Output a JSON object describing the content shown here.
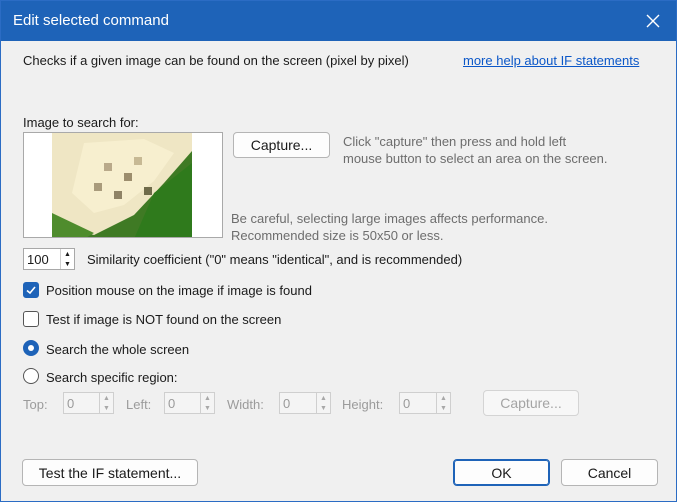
{
  "window": {
    "title": "Edit selected command"
  },
  "header": {
    "description": "Checks if a given image can be found on the screen (pixel by pixel)",
    "help_link": "more help about IF statements"
  },
  "image_section": {
    "label": "Image to search for:",
    "capture_button": "Capture...",
    "capture_hint_line1": "Click \"capture\" then press and hold left",
    "capture_hint_line2": "mouse button to select an area on the screen.",
    "warning_line1": "Be careful, selecting large images affects performance.",
    "warning_line2": "Recommended size is 50x50 or less."
  },
  "similarity": {
    "value": "100",
    "label": "Similarity coefficient (\"0\" means \"identical\", and is recommended)"
  },
  "options": {
    "position_mouse": {
      "label": "Position mouse on the image if image is found",
      "checked": true
    },
    "test_not_found": {
      "label": "Test if image is NOT found on the screen",
      "checked": false
    }
  },
  "search_mode": {
    "whole_screen": {
      "label": "Search the whole screen",
      "selected": true
    },
    "specific_region": {
      "label": "Search specific region:",
      "selected": false
    }
  },
  "region": {
    "top_label": "Top:",
    "top_value": "0",
    "left_label": "Left:",
    "left_value": "0",
    "width_label": "Width:",
    "width_value": "0",
    "height_label": "Height:",
    "height_value": "0",
    "capture_button": "Capture..."
  },
  "footer": {
    "test_button": "Test the IF statement...",
    "ok_button": "OK",
    "cancel_button": "Cancel"
  },
  "colors": {
    "accent": "#1e63b8",
    "link": "#0b57c8"
  }
}
